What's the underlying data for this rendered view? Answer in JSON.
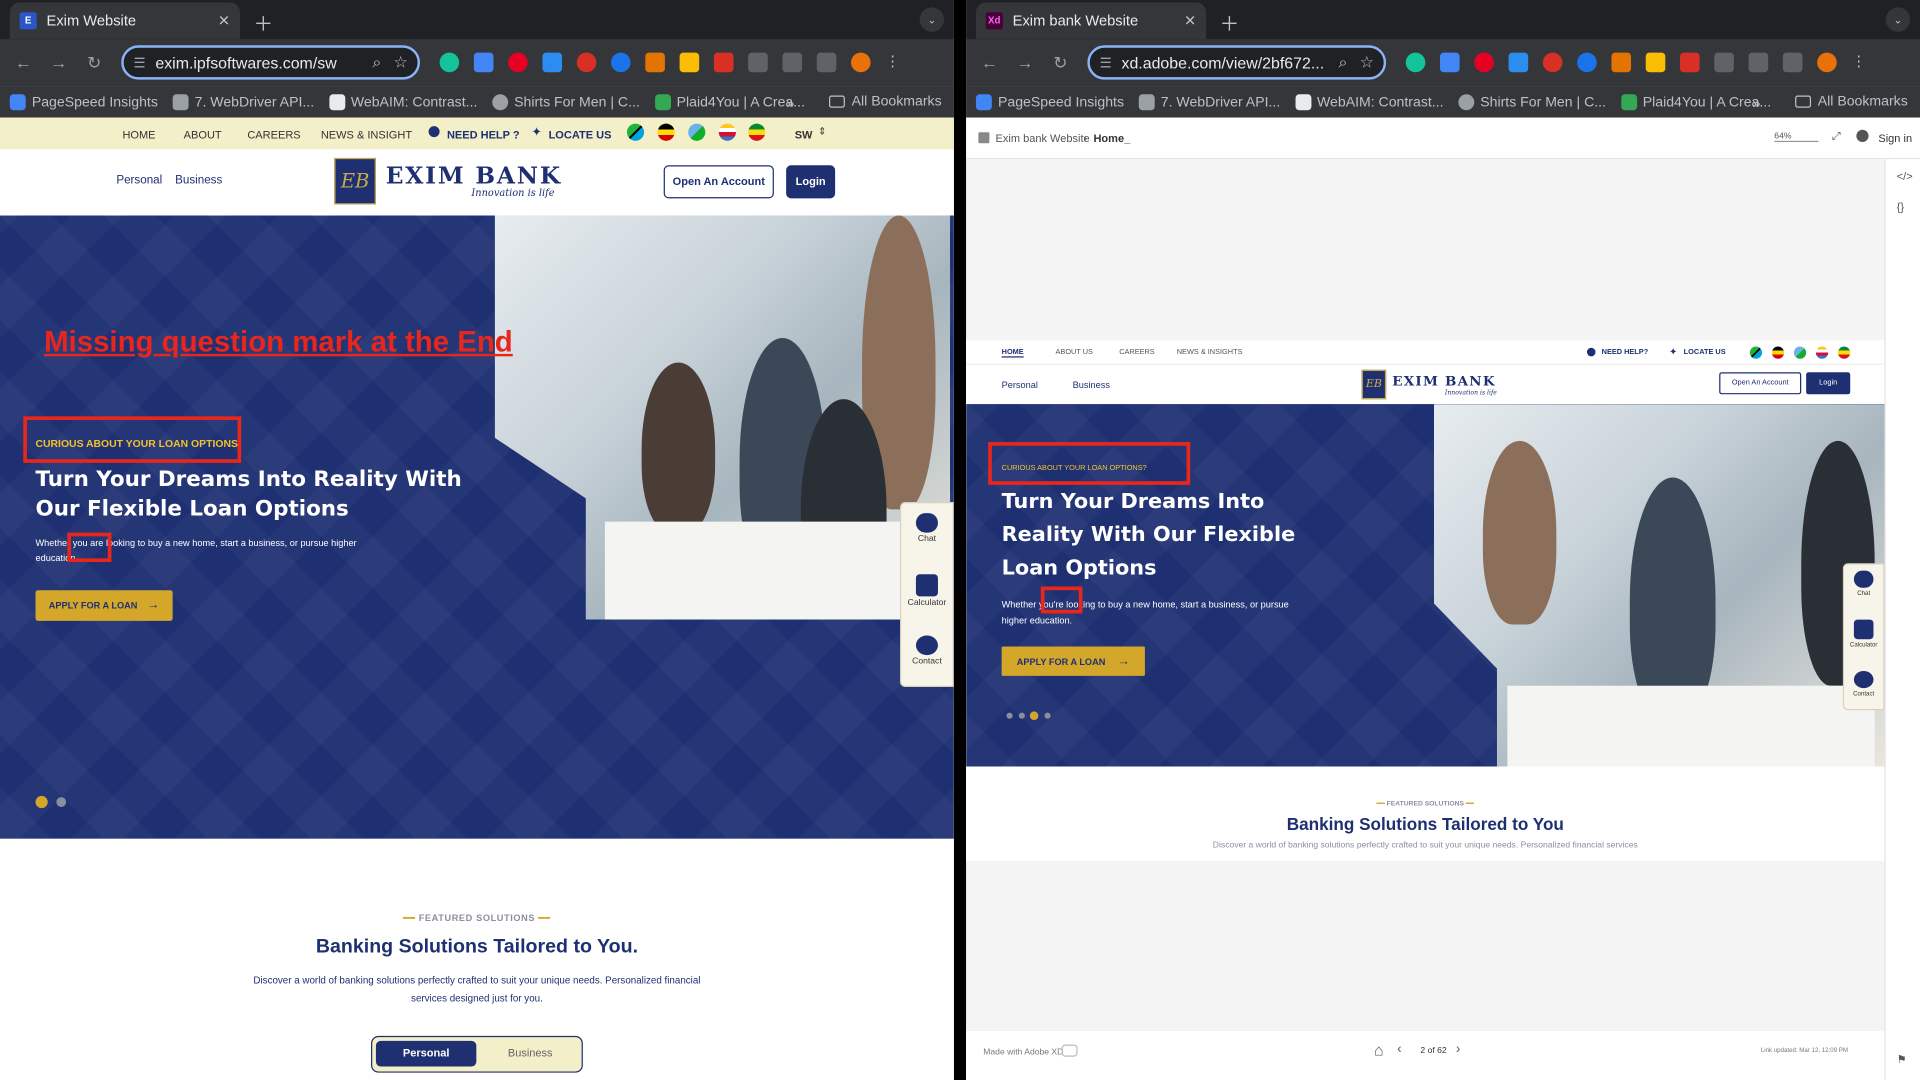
{
  "left": {
    "tab_title": "Exim Website",
    "url": "exim.ipfsoftwares.com/sw",
    "bookmarks": [
      "PageSpeed Insights",
      "7. WebDriver API...",
      "WebAIM: Contrast...",
      "Shirts For Men | C...",
      "Plaid4You | A Crea..."
    ],
    "all_bookmarks": "All Bookmarks",
    "topnav": [
      "HOME",
      "ABOUT",
      "CAREERS",
      "NEWS & INSIGHT"
    ],
    "need_help": "NEED HELP ?",
    "locate_us": "LOCATE US",
    "lang": "SW",
    "nav_personal": "Personal",
    "nav_business": "Business",
    "brand": "EXIM BANK",
    "tagline": "Innovation is life",
    "open_account": "Open An Account",
    "login": "Login",
    "annotation": "Missing question mark at the End",
    "eyebrow": "CURIOUS ABOUT YOUR LOAN OPTIONS",
    "hero_title_1": "Turn Your Dreams Into Reality With",
    "hero_title_2": "Our Flexible Loan Options",
    "hero_sub_1": "Whether you are looking to buy a new home, start a business, or pursue higher",
    "hero_sub_2": "education.",
    "apply": "APPLY FOR A LOAN",
    "widgets": [
      "Chat",
      "Calculator",
      "Contact"
    ],
    "featured": "FEATURED SOLUTIONS",
    "section_title": "Banking Solutions Tailored to You.",
    "section_desc_1": "Discover a world of banking solutions perfectly crafted to suit your unique needs. Personalized financial",
    "section_desc_2": "services designed just for you.",
    "seg_personal": "Personal",
    "seg_business": "Business"
  },
  "right": {
    "tab_title": "Exim bank Website",
    "url": "xd.adobe.com/view/2bf672...",
    "bookmarks": [
      "PageSpeed Insights",
      "7. WebDriver API...",
      "WebAIM: Contrast...",
      "Shirts For Men | C...",
      "Plaid4You | A Crea..."
    ],
    "all_bookmarks": "All Bookmarks",
    "breadcrumb_root": "Exim bank Website",
    "breadcrumb_page": "Home_",
    "zoom": "64%",
    "sign_in": "Sign in",
    "topnav": [
      "HOME",
      "ABOUT US",
      "CAREERS",
      "NEWS & INSIGHTS"
    ],
    "need_help": "NEED HELP?",
    "locate_us": "LOCATE US",
    "nav_personal": "Personal",
    "nav_business": "Business",
    "brand": "EXIM BANK",
    "tagline": "Innovation is life",
    "open_account": "Open An Account",
    "login": "Login",
    "eyebrow": "CURIOUS ABOUT YOUR LOAN OPTIONS?",
    "hero_title_1": "Turn Your Dreams Into",
    "hero_title_2": "Reality With Our Flexible",
    "hero_title_3": "Loan Options",
    "hero_sub_1": "Whether you're looking to buy a new home, start a business, or pursue",
    "hero_sub_2": "higher education.",
    "apply": "APPLY FOR A LOAN",
    "widgets": [
      "Chat",
      "Calculator",
      "Contact"
    ],
    "featured": "FEATURED SOLUTIONS",
    "section_title": "Banking Solutions Tailored to You",
    "section_desc": "Discover a world of banking solutions perfectly crafted to suit your unique needs. Personalized financial services",
    "made_with": "Made with Adobe XD",
    "pager": "2 of 62",
    "link_updated": "Link updated: Mar 12, 12:09 PM"
  },
  "colors": {
    "navy": "#1e3072",
    "gold": "#d4a62a",
    "annotation_red": "#e8261c"
  }
}
